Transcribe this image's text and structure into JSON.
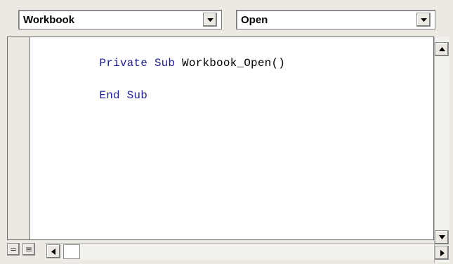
{
  "object_combo": {
    "value": "Workbook"
  },
  "procedure_combo": {
    "value": "Open"
  },
  "code": {
    "lines": [
      {
        "keyword": "Private Sub ",
        "identifier": "Workbook_Open()"
      },
      {
        "keyword": "End Sub",
        "identifier": ""
      }
    ]
  },
  "icons": {
    "combo_dropdown": "chevron-down-icon",
    "scroll_up": "arrow-up-icon",
    "scroll_down": "arrow-down-icon",
    "scroll_left": "arrow-left-icon",
    "scroll_right": "arrow-right-icon",
    "procedure_view": "procedure-view-icon",
    "full_module_view": "full-module-view-icon"
  },
  "colors": {
    "keyword": "#1e1e9e",
    "identifier": "#000000",
    "chrome": "#ece9e2"
  }
}
